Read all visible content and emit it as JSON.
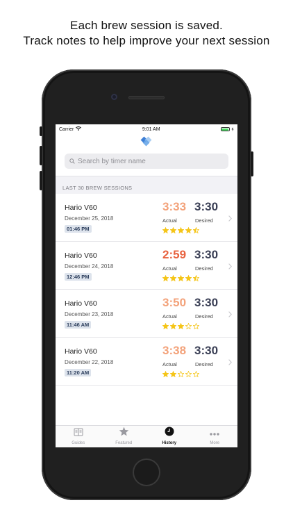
{
  "caption": {
    "line1": "Each brew session is saved.",
    "line2": "Track notes to help improve your next session"
  },
  "status_bar": {
    "carrier": "Carrier",
    "time": "9:01 AM"
  },
  "search": {
    "placeholder": "Search by timer name"
  },
  "section": {
    "header": "LAST 30 BREW SESSIONS"
  },
  "labels": {
    "actual": "Actual",
    "desired": "Desired"
  },
  "sessions": [
    {
      "name": "Hario V60",
      "date": "December 25, 2018",
      "time": "01:46 PM",
      "actual": "3:33",
      "desired": "3:30",
      "rating": 4.5,
      "actual_color": "#f3a27a"
    },
    {
      "name": "Hario V60",
      "date": "December 24, 2018",
      "time": "12:46 PM",
      "actual": "2:59",
      "desired": "3:30",
      "rating": 4.5,
      "actual_color": "#e8613e"
    },
    {
      "name": "Hario V60",
      "date": "December 23, 2018",
      "time": "11:46 AM",
      "actual": "3:50",
      "desired": "3:30",
      "rating": 3,
      "actual_color": "#f3a27a"
    },
    {
      "name": "Hario V60",
      "date": "December 22, 2018",
      "time": "11:20 AM",
      "actual": "3:38",
      "desired": "3:30",
      "rating": 2,
      "actual_color": "#f3a27a"
    }
  ],
  "tabs": [
    {
      "label": "Guides",
      "icon": "guides-icon",
      "active": false
    },
    {
      "label": "Featured",
      "icon": "star-icon",
      "active": false
    },
    {
      "label": "History",
      "icon": "clock-icon",
      "active": true
    },
    {
      "label": "More",
      "icon": "more-icon",
      "active": false
    }
  ],
  "colors": {
    "star": "#f5c518",
    "desired_time": "#3a3f55",
    "badge_bg": "#dde3ec",
    "logo_blue": "#3d7fd6",
    "logo_light": "#a9cdf2"
  }
}
